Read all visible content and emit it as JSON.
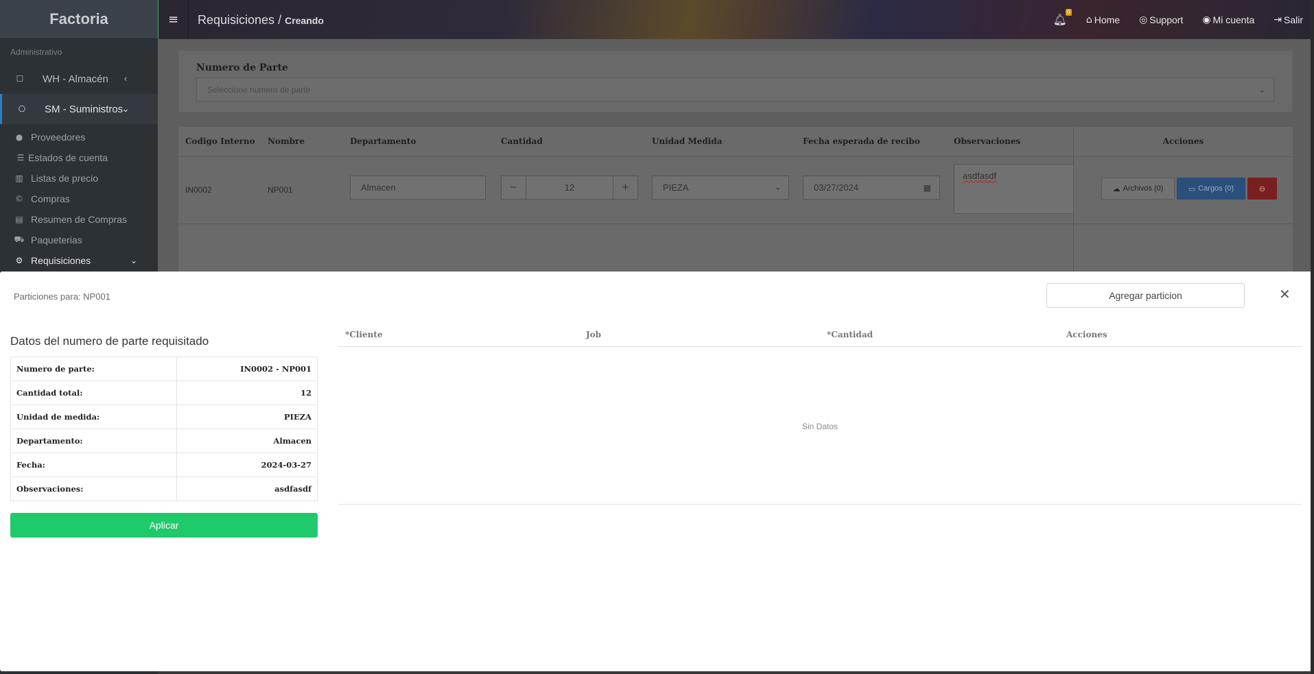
{
  "sidebar": {
    "brand": "Factoria",
    "section": "Administrativo",
    "modules": [
      {
        "label": "WH - Almacén",
        "icon": "square-icon"
      },
      {
        "label": "SM - Suministros",
        "icon": "network-icon"
      }
    ],
    "items": [
      {
        "label": "Proveedores",
        "icon": "user-icon"
      },
      {
        "label": "Estados de cuenta",
        "icon": "list-icon"
      },
      {
        "label": "Listas de precio",
        "icon": "bar-chart-icon"
      },
      {
        "label": "Compras",
        "icon": "copyright-icon"
      },
      {
        "label": "Resumen de Compras",
        "icon": "document-icon"
      },
      {
        "label": "Paqueterias",
        "icon": "car-icon"
      },
      {
        "label": "Requisiciones",
        "icon": "gear-icon"
      }
    ]
  },
  "topbar": {
    "title": "Requisiciones",
    "separator": " / ",
    "subtitle": "Creando",
    "notif_count": "0",
    "links": {
      "home": "Home",
      "support": "Support",
      "account": "Mi cuenta",
      "logout": "Salir"
    }
  },
  "part_select": {
    "label": "Numero de Parte",
    "placeholder": "Seleccione numero de parte"
  },
  "req_table": {
    "headers": [
      "Codigo Interno",
      "Nombre",
      "Departamento",
      "Cantidad",
      "Unidad Medida",
      "Fecha esperada de recibo",
      "Observaciones",
      "Acciones"
    ],
    "row": {
      "codigo": "IN0002",
      "nombre": "NP001",
      "departamento": "Almacen",
      "cantidad": "12",
      "unidad": "PIEZA",
      "fecha": "03/27/2024",
      "observaciones": "asdfasdf",
      "archivos": "Archivos (0)",
      "cargos": "Cargos (0)"
    }
  },
  "modal": {
    "title": "Particiones para: NP001",
    "add_button": "Agregar particion",
    "data_title": "Datos del numero de parte requisitado",
    "info": [
      {
        "label": "Numero de parte:",
        "value": "IN0002 - NP001"
      },
      {
        "label": "Cantidad total:",
        "value": "12"
      },
      {
        "label": "Unidad de medida:",
        "value": "PIEZA"
      },
      {
        "label": "Departamento:",
        "value": "Almacen"
      },
      {
        "label": "Fecha:",
        "value": "2024-03-27"
      },
      {
        "label": "Observaciones:",
        "value": "asdfasdf"
      }
    ],
    "apply_button": "Aplicar",
    "partition_headers": [
      "*Cliente",
      "Job",
      "*Cantidad",
      "Acciones"
    ],
    "empty_text": "Sin Datos"
  },
  "colors": {
    "sidebar": "#2c3136",
    "primary": "#3a86d6",
    "success": "#1fca6a",
    "danger": "#d93a3a",
    "badge": "#d69a19"
  }
}
